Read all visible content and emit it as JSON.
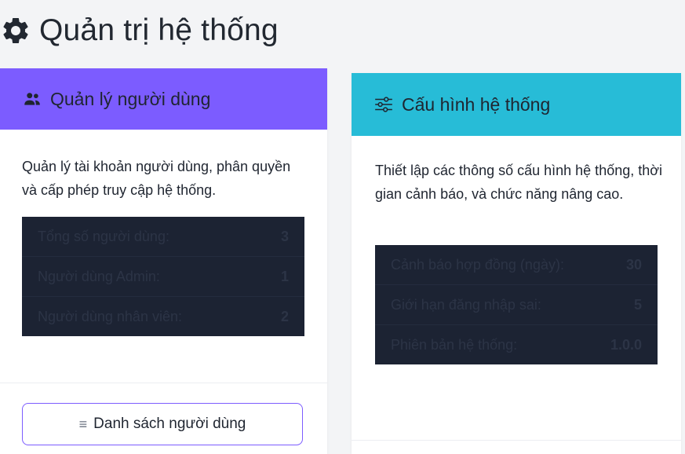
{
  "page": {
    "title": "Quản trị hệ thống",
    "title_icon": "gear-icon"
  },
  "user_management": {
    "header": "Quản lý người dùng",
    "header_icon": "users-icon",
    "header_color": "#7c5cff",
    "description": "Quản lý tài khoản người dùng, phân quyền và cấp phép truy cập hệ thống.",
    "stats": [
      {
        "label": "Tổng số người dùng:",
        "value": "3"
      },
      {
        "label": "Người dùng Admin:",
        "value": "1"
      },
      {
        "label": "Người dùng nhân viên:",
        "value": "2"
      }
    ],
    "button_label": "Danh sách người dùng",
    "button_icon": "list-icon"
  },
  "system_config": {
    "header": "Cấu hình hệ thống",
    "header_icon": "sliders-icon",
    "header_color": "#27bcd7",
    "description": "Thiết lập các thông số cấu hình hệ thống, thời gian cảnh báo, và chức năng nâng cao.",
    "stats": [
      {
        "label": "Cảnh báo hợp đồng (ngày):",
        "value": "30"
      },
      {
        "label": "Giới hạn đăng nhập sai:",
        "value": "5"
      },
      {
        "label": "Phiên bản hệ thống:",
        "value": "1.0.0"
      }
    ]
  }
}
